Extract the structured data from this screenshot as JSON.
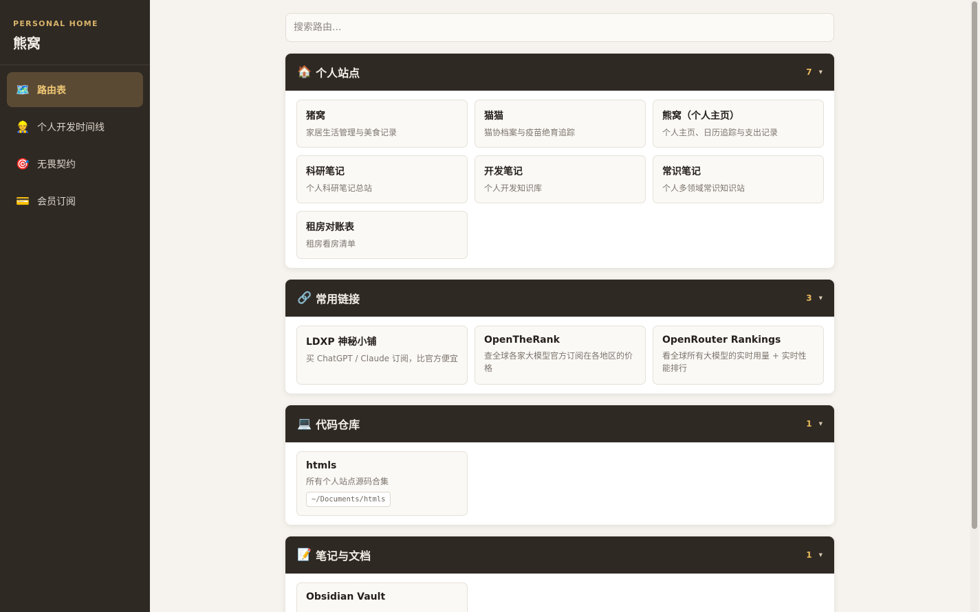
{
  "brand": {
    "eyebrow": "PERSONAL HOME",
    "title": "熊窝"
  },
  "nav": [
    {
      "icon": "🗺️",
      "label": "路由表",
      "active": true
    },
    {
      "icon": "👷",
      "label": "个人开发时间线",
      "active": false
    },
    {
      "icon": "🎯",
      "label": "无畏契约",
      "active": false
    },
    {
      "icon": "💳",
      "label": "会员订阅",
      "active": false
    }
  ],
  "search": {
    "placeholder": "搜索路由..."
  },
  "sections": [
    {
      "emoji": "🏠",
      "title": "个人站点",
      "count": "7",
      "cards": [
        {
          "title": "猪窝",
          "desc": "家居生活管理与美食记录"
        },
        {
          "title": "猫猫",
          "desc": "猫协档案与疫苗绝育追踪"
        },
        {
          "title": "熊窝（个人主页）",
          "desc": "个人主页、日历追踪与支出记录"
        },
        {
          "title": "科研笔记",
          "desc": "个人科研笔记总站"
        },
        {
          "title": "开发笔记",
          "desc": "个人开发知识库"
        },
        {
          "title": "常识笔记",
          "desc": "个人多领域常识知识站"
        },
        {
          "title": "租房对账表",
          "desc": "租房看房清单"
        }
      ]
    },
    {
      "emoji": "🔗",
      "title": "常用链接",
      "count": "3",
      "cards": [
        {
          "title": "LDXP 神秘小铺",
          "desc": "买 ChatGPT / Claude 订阅，比官方便宜"
        },
        {
          "title": "OpenTheRank",
          "desc": "查全球各家大模型官方订阅在各地区的价格"
        },
        {
          "title": "OpenRouter Rankings",
          "desc": "看全球所有大模型的实时用量 + 实时性能排行"
        }
      ]
    },
    {
      "emoji": "💻",
      "title": "代码仓库",
      "count": "1",
      "cards": [
        {
          "title": "htmls",
          "desc": "所有个人站点源码合集",
          "path": "~/Documents/htmls"
        }
      ]
    },
    {
      "emoji": "📝",
      "title": "笔记与文档",
      "count": "1",
      "cards": [
        {
          "title": "Obsidian Vault",
          "desc": ""
        }
      ]
    }
  ],
  "colors": {
    "sidebar_bg": "#2f2924",
    "accent_gold": "#e7b95a",
    "active_nav_bg": "#5a4a34",
    "page_bg": "#f6f3ee"
  }
}
